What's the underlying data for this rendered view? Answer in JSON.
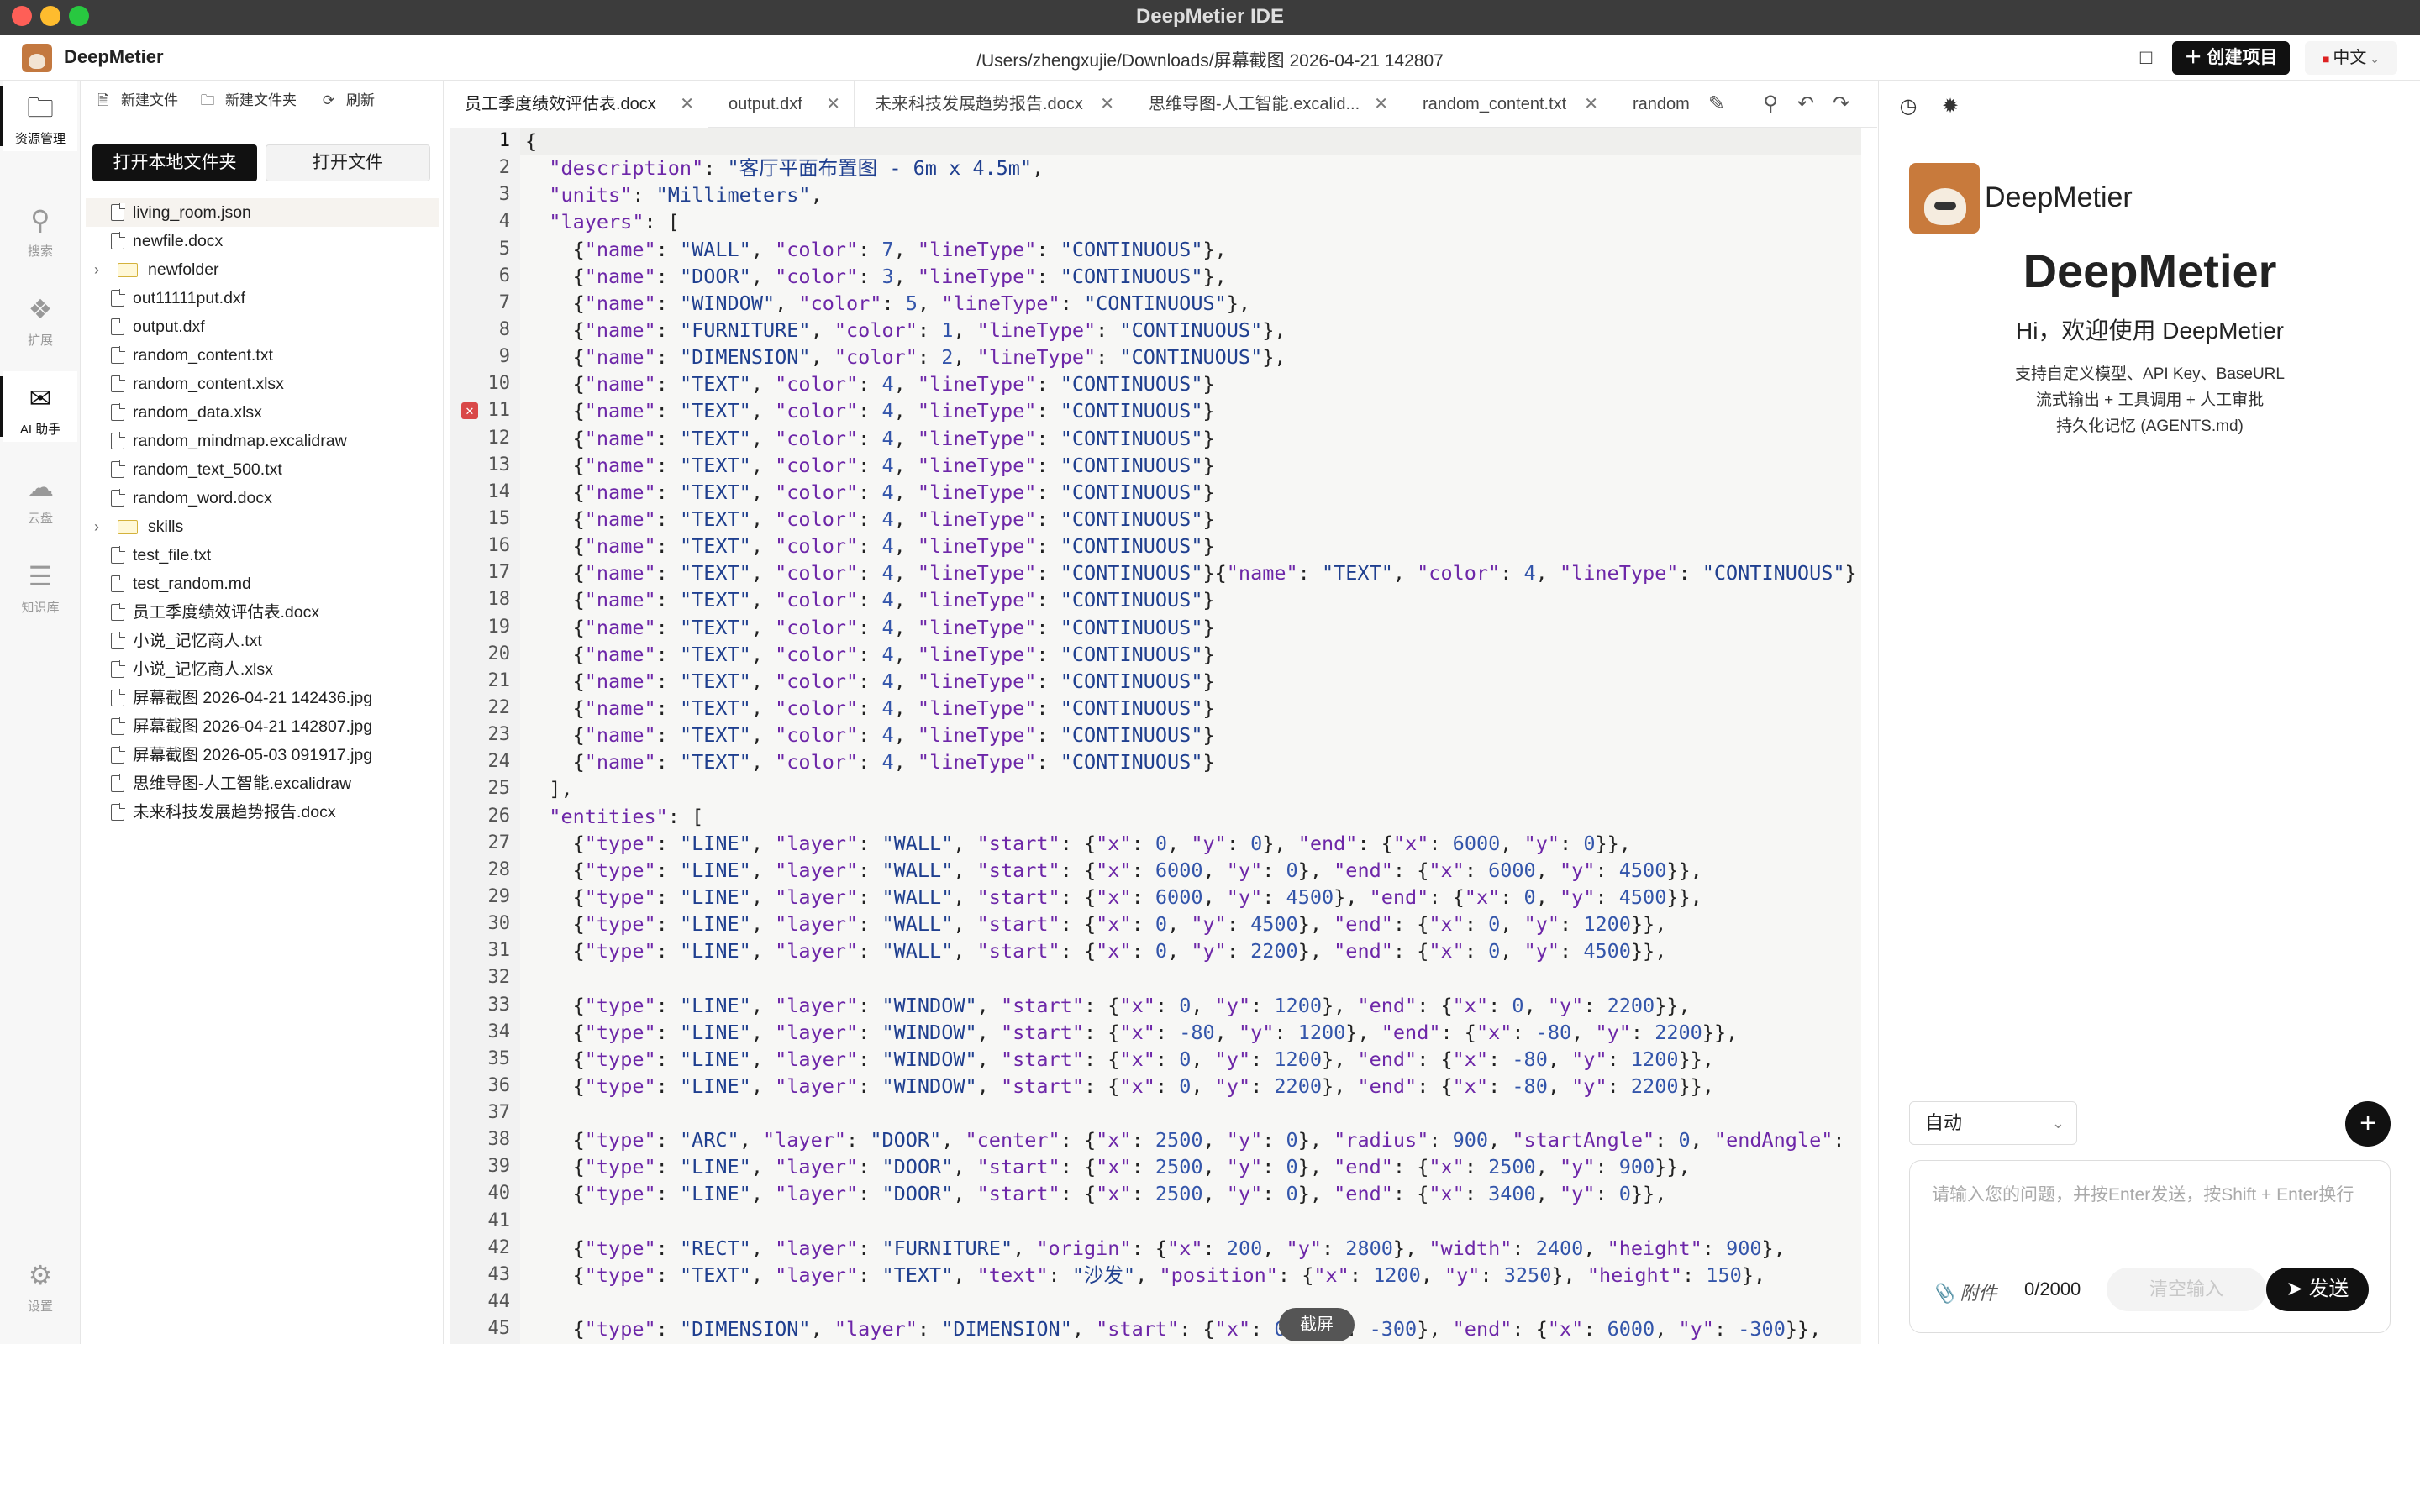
{
  "window": {
    "title": "DeepMetier IDE"
  },
  "header": {
    "brand": "DeepMetier",
    "path": "/Users/zhengxujie/Downloads/屏幕截图 2026-04-21 142807",
    "create_label": "创建项目",
    "lang_label": "中文"
  },
  "activity": [
    {
      "label": "资源管理",
      "icon": "folder-icon"
    },
    {
      "label": "搜索",
      "icon": "search-icon"
    },
    {
      "label": "扩展",
      "icon": "puzzle-icon"
    },
    {
      "label": "AI 助手",
      "icon": "chat-icon"
    },
    {
      "label": "云盘",
      "icon": "cloud-icon"
    },
    {
      "label": "知识库",
      "icon": "book-icon"
    },
    {
      "label": "设置",
      "icon": "gear-icon"
    }
  ],
  "explorer": {
    "new_file": "新建文件",
    "new_folder": "新建文件夹",
    "refresh": "刷新",
    "open_folder": "打开本地文件夹",
    "open_file": "打开文件",
    "files": [
      {
        "name": "living_room.json",
        "type": "file"
      },
      {
        "name": "newfile.docx",
        "type": "file"
      },
      {
        "name": "newfolder",
        "type": "folder"
      },
      {
        "name": "out11111put.dxf",
        "type": "file"
      },
      {
        "name": "output.dxf",
        "type": "file"
      },
      {
        "name": "random_content.txt",
        "type": "file"
      },
      {
        "name": "random_content.xlsx",
        "type": "file"
      },
      {
        "name": "random_data.xlsx",
        "type": "file"
      },
      {
        "name": "random_mindmap.excalidraw",
        "type": "file"
      },
      {
        "name": "random_text_500.txt",
        "type": "file"
      },
      {
        "name": "random_word.docx",
        "type": "file"
      },
      {
        "name": "skills",
        "type": "folder"
      },
      {
        "name": "test_file.txt",
        "type": "file"
      },
      {
        "name": "test_random.md",
        "type": "file"
      },
      {
        "name": "员工季度绩效评估表.docx",
        "type": "file"
      },
      {
        "name": "小说_记忆商人.txt",
        "type": "file"
      },
      {
        "name": "小说_记忆商人.xlsx",
        "type": "file"
      },
      {
        "name": "屏幕截图 2026-04-21 142436.jpg",
        "type": "file"
      },
      {
        "name": "屏幕截图 2026-04-21 142807.jpg",
        "type": "file"
      },
      {
        "name": "屏幕截图 2026-05-03 091917.jpg",
        "type": "file"
      },
      {
        "name": "思维导图-人工智能.excalidraw",
        "type": "file"
      },
      {
        "name": "未来科技发展趋势报告.docx",
        "type": "file"
      }
    ]
  },
  "editor": {
    "tabs": [
      {
        "label": "员工季度绩效评估表.docx"
      },
      {
        "label": "output.dxf"
      },
      {
        "label": "未来科技发展趋势报告.docx"
      },
      {
        "label": "思维导图-人工智能.excalid..."
      },
      {
        "label": "random_content.txt"
      },
      {
        "label": "random"
      }
    ],
    "capture_label": "截屏",
    "lines": [
      "{",
      "  \"description\": \"客厅平面布置图 - 6m x 4.5m\",",
      "  \"units\": \"Millimeters\",",
      "  \"layers\": [",
      "    {\"name\": \"WALL\", \"color\": 7, \"lineType\": \"CONTINUOUS\"},",
      "    {\"name\": \"DOOR\", \"color\": 3, \"lineType\": \"CONTINUOUS\"},",
      "    {\"name\": \"WINDOW\", \"color\": 5, \"lineType\": \"CONTINUOUS\"},",
      "    {\"name\": \"FURNITURE\", \"color\": 1, \"lineType\": \"CONTINUOUS\"},",
      "    {\"name\": \"DIMENSION\", \"color\": 2, \"lineType\": \"CONTINUOUS\"},",
      "    {\"name\": \"TEXT\", \"color\": 4, \"lineType\": \"CONTINUOUS\"}",
      "    {\"name\": \"TEXT\", \"color\": 4, \"lineType\": \"CONTINUOUS\"}",
      "    {\"name\": \"TEXT\", \"color\": 4, \"lineType\": \"CONTINUOUS\"}",
      "    {\"name\": \"TEXT\", \"color\": 4, \"lineType\": \"CONTINUOUS\"}",
      "    {\"name\": \"TEXT\", \"color\": 4, \"lineType\": \"CONTINUOUS\"}",
      "    {\"name\": \"TEXT\", \"color\": 4, \"lineType\": \"CONTINUOUS\"}",
      "    {\"name\": \"TEXT\", \"color\": 4, \"lineType\": \"CONTINUOUS\"}",
      "    {\"name\": \"TEXT\", \"color\": 4, \"lineType\": \"CONTINUOUS\"}{\"name\": \"TEXT\", \"color\": 4, \"lineType\": \"CONTINUOUS\"}",
      "    {\"name\": \"TEXT\", \"color\": 4, \"lineType\": \"CONTINUOUS\"}",
      "    {\"name\": \"TEXT\", \"color\": 4, \"lineType\": \"CONTINUOUS\"}",
      "    {\"name\": \"TEXT\", \"color\": 4, \"lineType\": \"CONTINUOUS\"}",
      "    {\"name\": \"TEXT\", \"color\": 4, \"lineType\": \"CONTINUOUS\"}",
      "    {\"name\": \"TEXT\", \"color\": 4, \"lineType\": \"CONTINUOUS\"}",
      "    {\"name\": \"TEXT\", \"color\": 4, \"lineType\": \"CONTINUOUS\"}",
      "    {\"name\": \"TEXT\", \"color\": 4, \"lineType\": \"CONTINUOUS\"}",
      "  ],",
      "  \"entities\": [",
      "    {\"type\": \"LINE\", \"layer\": \"WALL\", \"start\": {\"x\": 0, \"y\": 0}, \"end\": {\"x\": 6000, \"y\": 0}},",
      "    {\"type\": \"LINE\", \"layer\": \"WALL\", \"start\": {\"x\": 6000, \"y\": 0}, \"end\": {\"x\": 6000, \"y\": 4500}},",
      "    {\"type\": \"LINE\", \"layer\": \"WALL\", \"start\": {\"x\": 6000, \"y\": 4500}, \"end\": {\"x\": 0, \"y\": 4500}},",
      "    {\"type\": \"LINE\", \"layer\": \"WALL\", \"start\": {\"x\": 0, \"y\": 4500}, \"end\": {\"x\": 0, \"y\": 1200}},",
      "    {\"type\": \"LINE\", \"layer\": \"WALL\", \"start\": {\"x\": 0, \"y\": 2200}, \"end\": {\"x\": 0, \"y\": 4500}},",
      "",
      "    {\"type\": \"LINE\", \"layer\": \"WINDOW\", \"start\": {\"x\": 0, \"y\": 1200}, \"end\": {\"x\": 0, \"y\": 2200}},",
      "    {\"type\": \"LINE\", \"layer\": \"WINDOW\", \"start\": {\"x\": -80, \"y\": 1200}, \"end\": {\"x\": -80, \"y\": 2200}},",
      "    {\"type\": \"LINE\", \"layer\": \"WINDOW\", \"start\": {\"x\": 0, \"y\": 1200}, \"end\": {\"x\": -80, \"y\": 1200}},",
      "    {\"type\": \"LINE\", \"layer\": \"WINDOW\", \"start\": {\"x\": 0, \"y\": 2200}, \"end\": {\"x\": -80, \"y\": 2200}},",
      "",
      "    {\"type\": \"ARC\", \"layer\": \"DOOR\", \"center\": {\"x\": 2500, \"y\": 0}, \"radius\": 900, \"startAngle\": 0, \"endAngle\":",
      "    {\"type\": \"LINE\", \"layer\": \"DOOR\", \"start\": {\"x\": 2500, \"y\": 0}, \"end\": {\"x\": 2500, \"y\": 900}},",
      "    {\"type\": \"LINE\", \"layer\": \"DOOR\", \"start\": {\"x\": 2500, \"y\": 0}, \"end\": {\"x\": 3400, \"y\": 0}},",
      "",
      "    {\"type\": \"RECT\", \"layer\": \"FURNITURE\", \"origin\": {\"x\": 200, \"y\": 2800}, \"width\": 2400, \"height\": 900},",
      "    {\"type\": \"TEXT\", \"layer\": \"TEXT\", \"text\": \"沙发\", \"position\": {\"x\": 1200, \"y\": 3250}, \"height\": 150},",
      "",
      "    {\"type\": \"DIMENSION\", \"layer\": \"DIMENSION\", \"start\": {\"x\": 0, \"y\": -300}, \"end\": {\"x\": 6000, \"y\": -300}},"
    ]
  },
  "panel": {
    "brand_small": "DeepMetier",
    "brand_big": "DeepMetier",
    "welcome": "Hi，欢迎使用 DeepMetier",
    "desc1": "支持自定义模型、API Key、BaseURL",
    "desc2": "流式输出 + 工具调用 + 人工审批",
    "desc3": "持久化记忆 (AGENTS.md)",
    "mode": "自动",
    "placeholder": "请输入您的问题，并按Enter发送，按Shift + Enter换行",
    "attach": "附件",
    "count": "0/2000",
    "clear": "清空输入",
    "send": "发送"
  }
}
